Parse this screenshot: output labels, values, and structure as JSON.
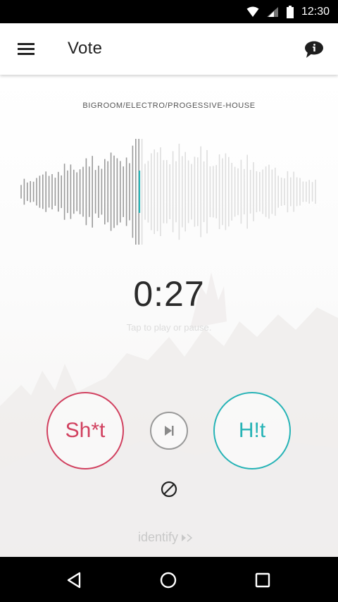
{
  "status_bar": {
    "time": "12:30"
  },
  "app_bar": {
    "title": "Vote",
    "menu_icon": "hamburger-menu-icon",
    "info_icon": "info-chat-icon"
  },
  "player": {
    "genre": "BIGROOM/ELECTRO/PROGESSIVE-HOUSE",
    "time": "0:27",
    "hint": "Tap to play or pause.",
    "progress": 0.4,
    "played_color": "#9a9a9a",
    "unplayed_color": "#dedede",
    "playhead_color": "#26b3b6"
  },
  "actions": {
    "shit_label": "Sh*t",
    "hit_label": "H!t",
    "shit_color": "#d1405f",
    "hit_color": "#26b3b6",
    "skip_icon": "skip-next-icon",
    "block_icon": "block-icon"
  },
  "branding": {
    "logo": "identify"
  },
  "nav_bar": {
    "back_icon": "back-triangle-icon",
    "home_icon": "home-circle-icon",
    "recent_icon": "recent-square-icon"
  }
}
